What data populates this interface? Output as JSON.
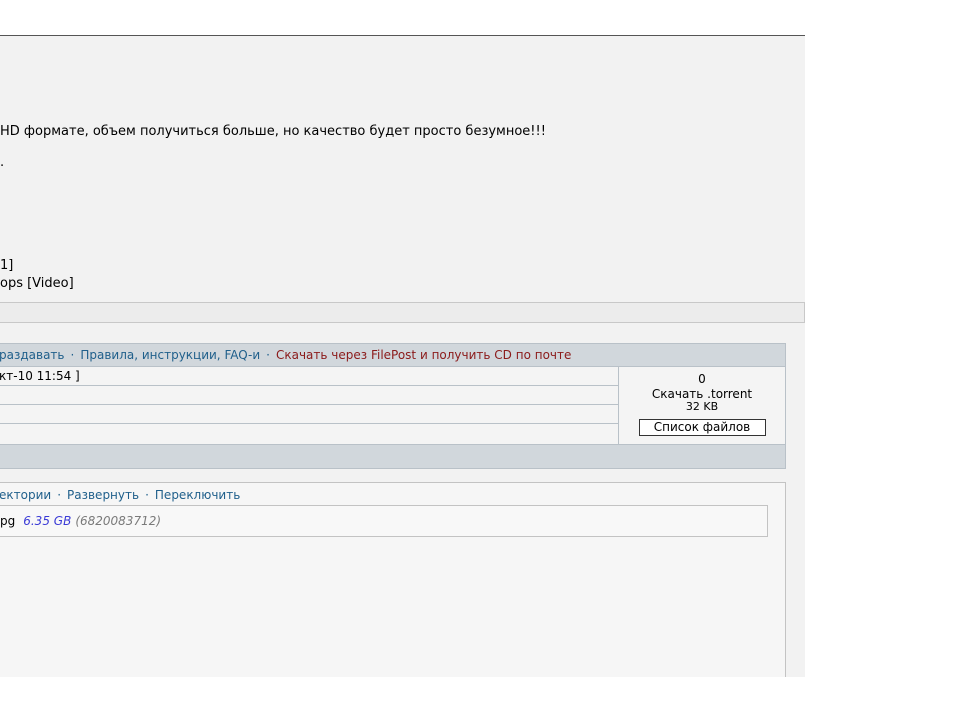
{
  "post": {
    "line1": "HD формате, объем получиться больше, но качество будет просто безумное!!!",
    "line2": ".",
    "line3": "1]",
    "line4": "ops [Video]"
  },
  "torrent": {
    "header_links": [
      {
        "label": "раздавать"
      },
      {
        "label": "Правила, инструкции, FAQ-и"
      },
      {
        "label": "Скачать через FilePost и получить CD по почте"
      }
    ],
    "separator": "·",
    "date_row": "кт-10 11:54 ]",
    "side": {
      "icon": "paperclip-icon",
      "icon_glyph": "0",
      "download_label": "Скачать .torrent",
      "size": "32 KB",
      "files_button": "Список файлов"
    }
  },
  "files": {
    "tools": [
      {
        "label": "ектории"
      },
      {
        "label": "Развернуть"
      },
      {
        "label": "Переключить"
      }
    ],
    "item": {
      "name": "pg",
      "size": "6.35 GB",
      "bytes": "(6820083712)"
    }
  },
  "colors": {
    "link": "#1f5f8b",
    "link_red": "#8b1a1a",
    "file_size": "#3a3ad6",
    "header_bg": "#d1d7dc"
  }
}
